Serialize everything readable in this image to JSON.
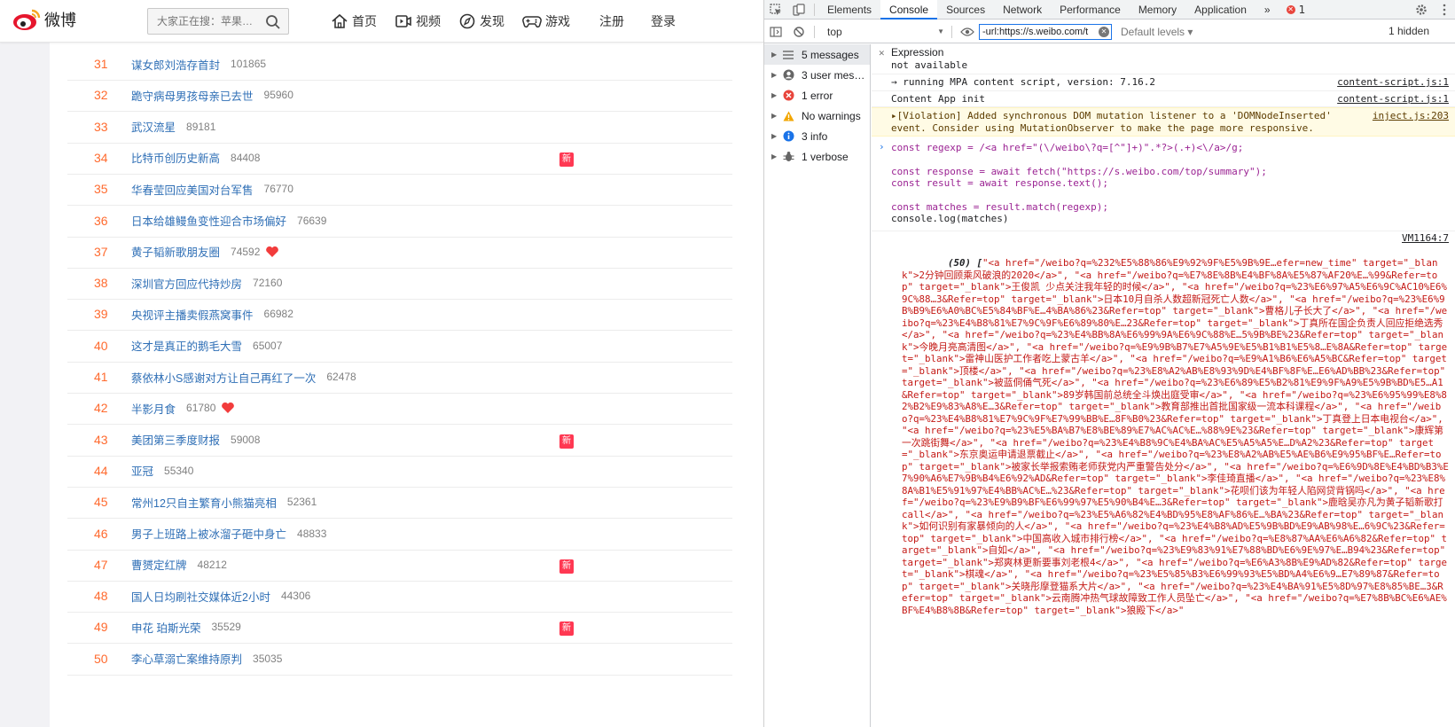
{
  "weibo": {
    "logo_text": "微博",
    "search_placeholder": "大家正在搜：苹果…",
    "nav": [
      {
        "label": "首页",
        "icon": "home-icon"
      },
      {
        "label": "视频",
        "icon": "video-icon"
      },
      {
        "label": "发现",
        "icon": "compass-icon"
      },
      {
        "label": "游戏",
        "icon": "gamepad-icon"
      }
    ],
    "register_label": "注册",
    "login_label": "登录",
    "new_badge_label": "新",
    "rows": [
      {
        "rank": "31",
        "topic": "谋女郎刘浩存首封",
        "count": "101865",
        "badge": ""
      },
      {
        "rank": "32",
        "topic": "跪守病母男孩母亲已去世",
        "count": "95960",
        "badge": ""
      },
      {
        "rank": "33",
        "topic": "武汉流星",
        "count": "89181",
        "badge": ""
      },
      {
        "rank": "34",
        "topic": "比特币创历史新高",
        "count": "84408",
        "badge": "new"
      },
      {
        "rank": "35",
        "topic": "华春莹回应美国对台军售",
        "count": "76770",
        "badge": ""
      },
      {
        "rank": "36",
        "topic": "日本给雄鳗鱼变性迎合市场偏好",
        "count": "76639",
        "badge": ""
      },
      {
        "rank": "37",
        "topic": "黄子韬新歌朋友圈",
        "count": "74592",
        "badge": "heart"
      },
      {
        "rank": "38",
        "topic": "深圳官方回应代持炒房",
        "count": "72160",
        "badge": ""
      },
      {
        "rank": "39",
        "topic": "央视评主播卖假燕窝事件",
        "count": "66982",
        "badge": ""
      },
      {
        "rank": "40",
        "topic": "这才是真正的鹅毛大雪",
        "count": "65007",
        "badge": ""
      },
      {
        "rank": "41",
        "topic": "蔡依林小S感谢对方让自己再红了一次",
        "count": "62478",
        "badge": ""
      },
      {
        "rank": "42",
        "topic": "半影月食",
        "count": "61780",
        "badge": "heart"
      },
      {
        "rank": "43",
        "topic": "美团第三季度财报",
        "count": "59008",
        "badge": "new"
      },
      {
        "rank": "44",
        "topic": "亚冠",
        "count": "55340",
        "badge": ""
      },
      {
        "rank": "45",
        "topic": "常州12只自主繁育小熊猫亮相",
        "count": "52361",
        "badge": ""
      },
      {
        "rank": "46",
        "topic": "男子上班路上被冰溜子砸中身亡",
        "count": "48833",
        "badge": ""
      },
      {
        "rank": "47",
        "topic": "曹赟定红牌",
        "count": "48212",
        "badge": "new"
      },
      {
        "rank": "48",
        "topic": "国人日均刷社交媒体近2小时",
        "count": "44306",
        "badge": ""
      },
      {
        "rank": "49",
        "topic": "申花 珀斯光荣",
        "count": "35529",
        "badge": "new"
      },
      {
        "rank": "50",
        "topic": "李心草溺亡案维持原判",
        "count": "35035",
        "badge": ""
      }
    ]
  },
  "devtools": {
    "tabs": [
      "Elements",
      "Console",
      "Sources",
      "Network",
      "Performance",
      "Memory",
      "Application"
    ],
    "active_tab": "Console",
    "more_tabs": "»",
    "error_count": "1",
    "context": "top",
    "filter_value": "-url:https://s.weibo.com/t",
    "default_levels": "Default levels ▾",
    "hidden_count": "1 hidden",
    "sidebar": [
      {
        "label": "5 messages",
        "icon": "list-icon",
        "active": true
      },
      {
        "label": "3 user mes…",
        "icon": "user-icon",
        "active": false
      },
      {
        "label": "1 error",
        "icon": "error-icon",
        "active": false
      },
      {
        "label": "No warnings",
        "icon": "warning-icon",
        "active": false
      },
      {
        "label": "3 info",
        "icon": "info-icon",
        "active": false
      },
      {
        "label": "1 verbose",
        "icon": "bug-icon",
        "active": false
      }
    ],
    "expression_label": "Expression",
    "expression_value": "not available",
    "log1": "→ running MPA content script, version: 7.16.2",
    "log1_src": "content-script.js:1",
    "log2": "Content App init",
    "log2_src": "content-script.js:1",
    "violation": "▸[Violation] Added synchronous DOM mutation listener to a 'DOMNodeInserted' event. Consider using MutationObserver to make the page more responsive.",
    "violation_src": "inject.js:203",
    "code_line1": "const regexp = /<a href=\"(\\/weibo\\?q=[^\"]+)\".*?>(.+)<\\/a>/g;",
    "code_line2": "const response = await fetch(\"https://s.weibo.com/top/summary\");",
    "code_line3": "const result = await response.text();",
    "code_line4": "const matches = result.match(regexp);",
    "code_line5": "console.log(matches)",
    "output_src": "VM1164:7",
    "output_count": "(50) [",
    "output_text": "\"<a href=\"/weibo?q=%232%E5%88%86%E9%92%9F%E5%9B%9E…efer=new_time\" target=\"_blank\">2分钟回顾乘风破浪的2020</a>\", \"<a href=\"/weibo?q=%E7%8E%8B%E4%BF%8A%E5%87%AF20%E…%99&Refer=top\" target=\"_blank\">王俊凯 少点关注我年轻的时候</a>\", \"<a href=\"/weibo?q=%23%E6%97%A5%E6%9C%AC10%E6%9C%88…3&Refer=top\" target=\"_blank\">日本10月自杀人数超新冠死亡人数</a>\", \"<a href=\"/weibo?q=%23%E6%9B%B9%E6%A0%BC%E5%84%BF%E…4%BA%86%23&Refer=top\" target=\"_blank\">曹格儿子长大了</a>\", \"<a href=\"/weibo?q=%23%E4%B8%81%E7%9C%9F%E6%89%80%E…23&Refer=top\" target=\"_blank\">丁真所在国企负责人回应拒绝选秀</a>\", \"<a href=\"/weibo?q=%23%E4%BB%8A%E6%99%9A%E6%9C%88%E…5%9B%BE%23&Refer=top\" target=\"_blank\">今晚月亮高清图</a>\", \"<a href=\"/weibo?q=%E9%9B%B7%E7%A5%9E%E5%B1%B1%E5%8…E%8A&Refer=top\" target=\"_blank\">雷神山医护工作者吃上蒙古羊</a>\", \"<a href=\"/weibo?q=%E9%A1%B6%E6%A5%BC&Refer=top\" target=\"_blank\">顶楼</a>\", \"<a href=\"/weibo?q=%23%E8%A2%AB%E8%93%9D%E4%BF%8F%E…E6%AD%BB%23&Refer=top\" target=\"_blank\">被蓝侗俑气死</a>\", \"<a href=\"/weibo?q=%23%E6%89%E5%B2%81%E9%9F%A9%E5%9B%BD%E5…A1&Refer=top\" target=\"_blank\">89岁韩国前总统全斗焕出庭受审</a>\", \"<a href=\"/weibo?q=%23%E6%95%99%E8%82%B2%E9%83%A8%E…3&Refer=top\" target=\"_blank\">教育部推出首批国家级一流本科课程</a>\", \"<a href=\"/weibo?q=%23%E4%B8%81%E7%9C%9F%E7%99%BB%E…8F%B0%23&Refer=top\" target=\"_blank\">丁真登上日本电视台</a>\", \"<a href=\"/weibo?q=%23%E5%BA%B7%E8%BE%89%E7%AC%AC%E…%88%9E%23&Refer=top\" target=\"_blank\">康辉第一次跳街舞</a>\", \"<a href=\"/weibo?q=%23%E4%B8%9C%E4%BA%AC%E5%A5%A5%E…D%A2%23&Refer=top\" target=\"_blank\">东京奥运申请退票截止</a>\", \"<a href=\"/weibo?q=%23%E8%A2%AB%E5%AE%B6%E9%95%BF%E…Refer=top\" target=\"_blank\">被家长举报索贿老师获党内严重警告处分</a>\", \"<a href=\"/weibo?q=%E6%9D%8E%E4%BD%B3%E7%90%A6%E7%9B%B4%E6%92%AD&Refer=top\" target=\"_blank\">李佳琦直播</a>\", \"<a href=\"/weibo?q=%23%E8%8A%B1%E5%91%97%E4%BB%AC%E…%23&Refer=top\" target=\"_blank\">花呗们该为年轻人陷网贷背锅吗</a>\", \"<a href=\"/weibo?q=%23%E9%B9%BF%E6%99%97%E5%90%B4%E…3&Refer=top\" target=\"_blank\">鹿晗吴亦凡为黄子韬新歌打call</a>\", \"<a href=\"/weibo?q=%23%E5%A6%82%E4%BD%95%E8%AF%86%E…%BA%23&Refer=top\" target=\"_blank\">如何识别有家暴倾向的人</a>\", \"<a href=\"/weibo?q=%23%E4%B8%AD%E5%9B%BD%E9%AB%98%E…6%9C%23&Refer=top\" target=\"_blank\">中国高收入城市排行榜</a>\", \"<a href=\"/weibo?q=%E8%87%AA%E6%A6%82&Refer=top\" target=\"_blank\">自如</a>\", \"<a href=\"/weibo?q=%23%E9%83%91%E7%88%BD%E6%9E%97%E…B94%23&Refer=top\" target=\"_blank\">郑爽林更新要事刘老根4</a>\", \"<a href=\"/weibo?q=%E6%A3%8B%E9%AD%82&Refer=top\" target=\"_blank\">棋魂</a>\", \"<a href=\"/weibo?q=%23%E5%85%B3%E6%99%93%E5%BD%A4%E6%9…E7%89%87&Refer=top\" target=\"_blank\">关晓彤摩登猫系大片</a>\", \"<a href=\"/weibo?q=%23%E4%BA%91%E5%8D%97%E8%85%BE…3&Refer=top\" target=\"_blank\">云南腾冲热气球故障致工作人员坠亡</a>\", \"<a href=\"/weibo?q=%E7%8B%BC%E6%AE%BF%E4%B8%8B&Refer=top\" target=\"_blank\">狼殿下</a>\""
  }
}
